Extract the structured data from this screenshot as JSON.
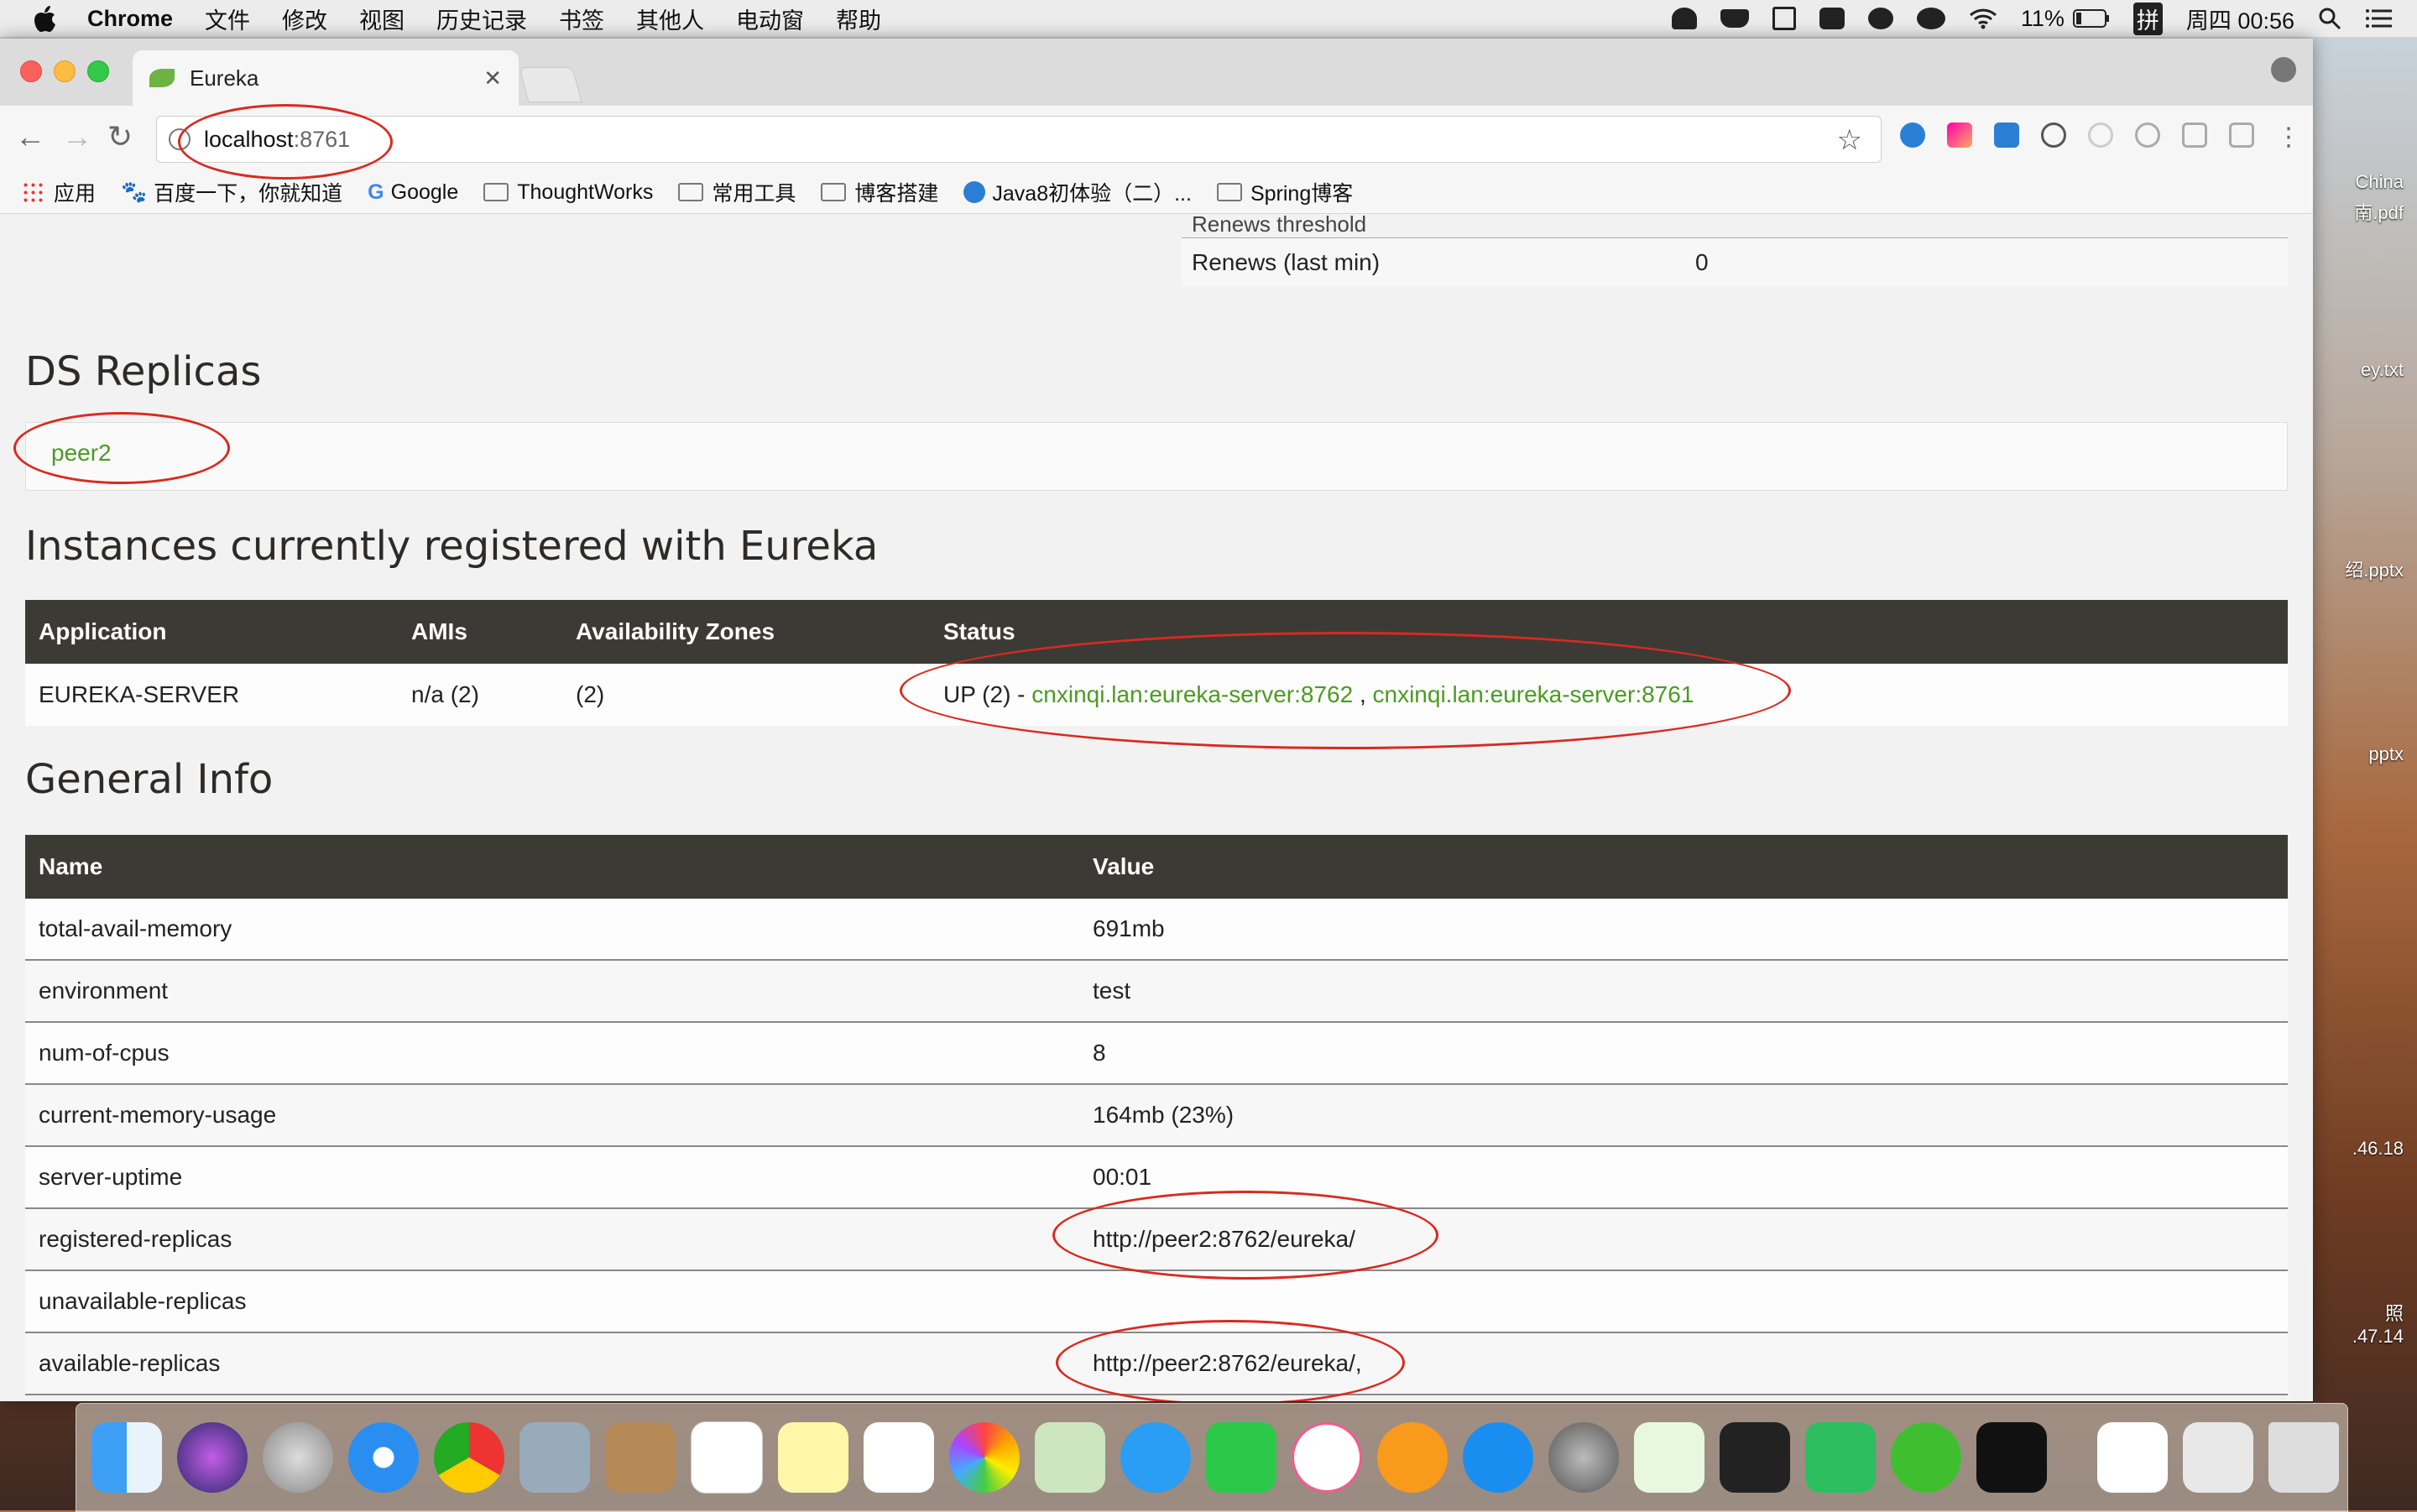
{
  "menubar": {
    "app": "Chrome",
    "items": [
      "文件",
      "修改",
      "视图",
      "历史记录",
      "书签",
      "其他人",
      "电动窗",
      "帮助"
    ],
    "battery": "11%",
    "input_method": "拼",
    "clock": "周四 00:56"
  },
  "browser": {
    "tab_title": "Eureka",
    "url_host": "localhost",
    "url_port": ":8761",
    "bookmarks": [
      "应用",
      "百度一下，你就知道",
      "Google",
      "ThoughtWorks",
      "常用工具",
      "博客搭建",
      "Java8初体验（二）...",
      "Spring博客"
    ]
  },
  "page": {
    "renews_cut_label": "Renews threshold",
    "renews_last_min_label": "Renews (last min)",
    "renews_last_min_value": "0",
    "ds_replicas_title": "DS Replicas",
    "ds_replica_link": "peer2",
    "instances_title": "Instances currently registered with Eureka",
    "instances_headers": [
      "Application",
      "AMIs",
      "Availability Zones",
      "Status"
    ],
    "instances_rows": [
      {
        "application": "EUREKA-SERVER",
        "amis": "n/a (2)",
        "zones": "(2)",
        "status_prefix": "UP (2) - ",
        "link1": "cnxinqi.lan:eureka-server:8762",
        "sep": " , ",
        "link2": "cnxinqi.lan:eureka-server:8761"
      }
    ],
    "general_title": "General Info",
    "general_headers": [
      "Name",
      "Value"
    ],
    "general_rows": [
      {
        "name": "total-avail-memory",
        "value": "691mb"
      },
      {
        "name": "environment",
        "value": "test"
      },
      {
        "name": "num-of-cpus",
        "value": "8"
      },
      {
        "name": "current-memory-usage",
        "value": "164mb (23%)"
      },
      {
        "name": "server-uptime",
        "value": "00:01"
      },
      {
        "name": "registered-replicas",
        "value": "http://peer2:8762/eureka/"
      },
      {
        "name": "unavailable-replicas",
        "value": ""
      },
      {
        "name": "available-replicas",
        "value": "http://peer2:8762/eureka/,"
      }
    ]
  },
  "desktop": {
    "files": [
      "China",
      "南.pdf",
      "ey.txt",
      "绍.pptx",
      "pptx",
      ".46.18",
      "照",
      ".47.14"
    ]
  },
  "colors": {
    "link_green": "#4c9a22",
    "table_header": "#3c3a34",
    "annotation_red": "#d92a20"
  }
}
